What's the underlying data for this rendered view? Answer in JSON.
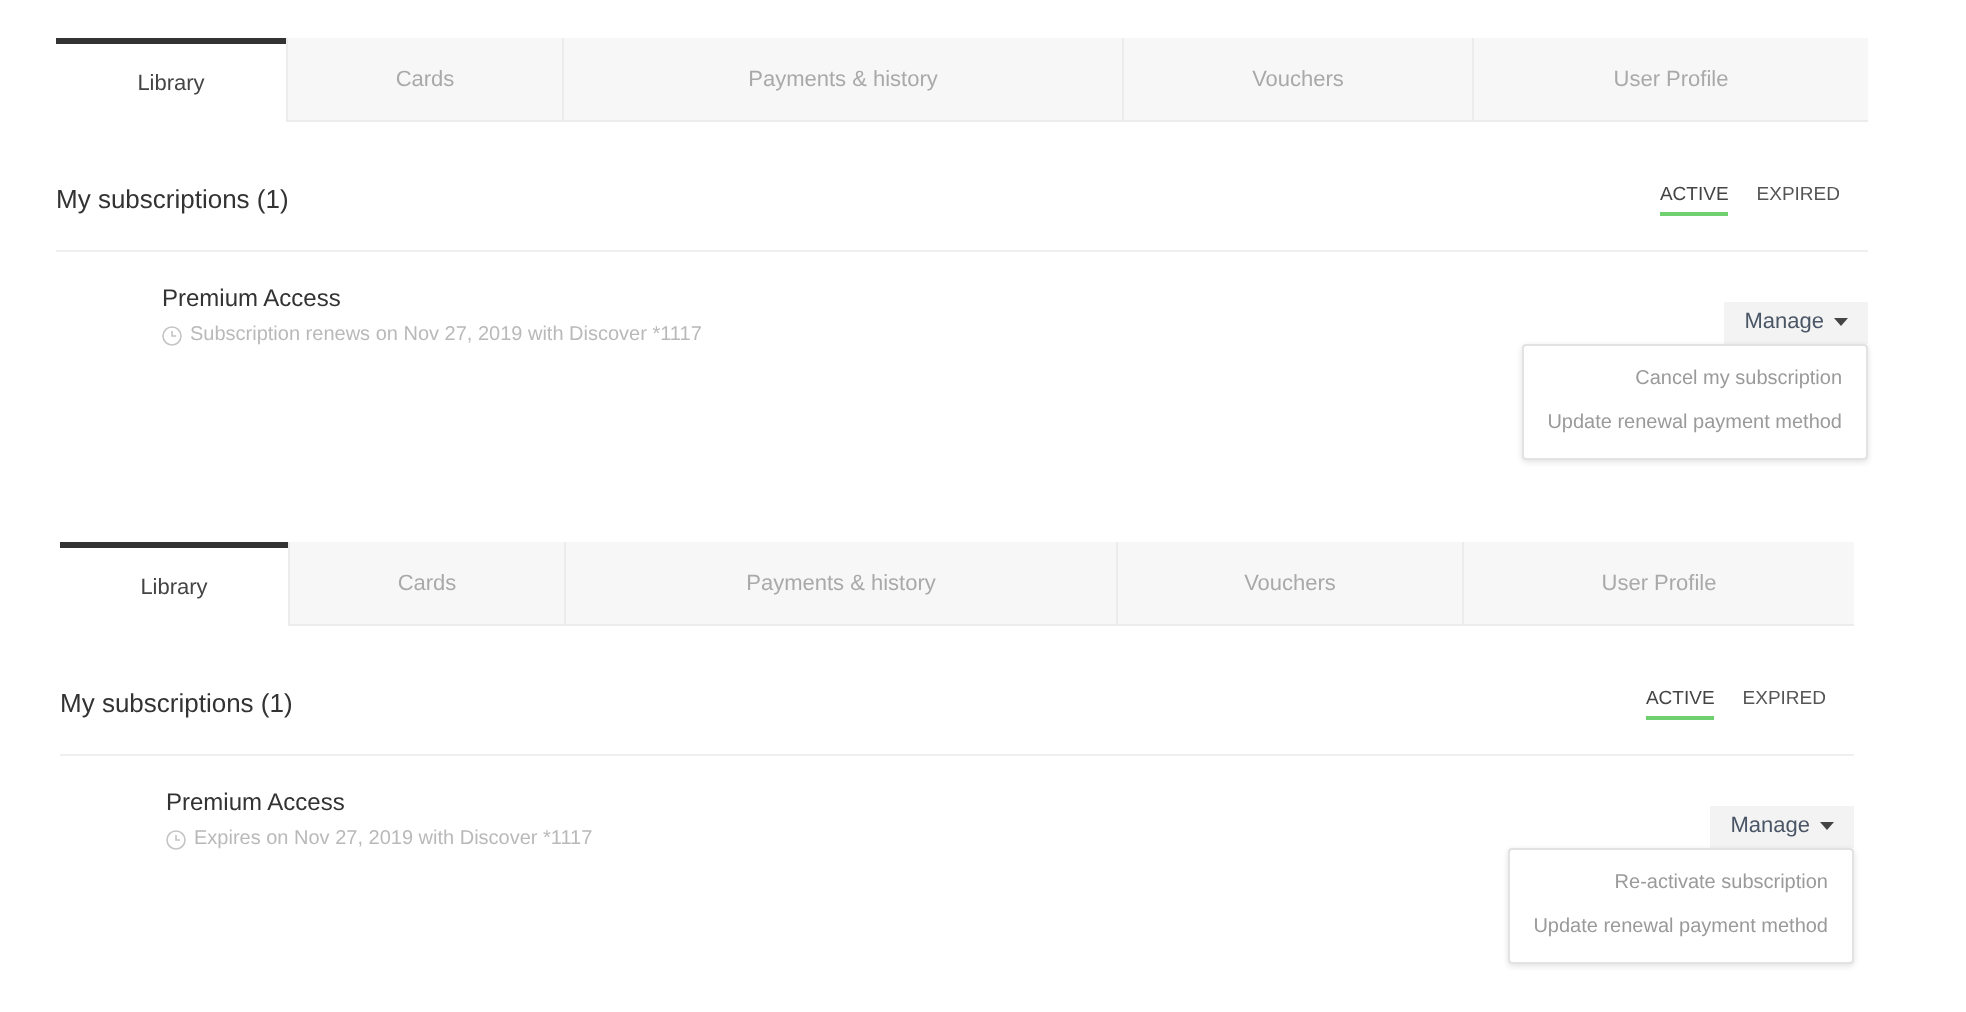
{
  "panels": [
    {
      "tabs": [
        {
          "label": "Library",
          "selected": true
        },
        {
          "label": "Cards",
          "selected": false
        },
        {
          "label": "Payments & history",
          "selected": false
        },
        {
          "label": "Vouchers",
          "selected": false
        },
        {
          "label": "User Profile",
          "selected": false
        }
      ],
      "title": "My subscriptions (1)",
      "filters": [
        {
          "label": "ACTIVE",
          "selected": true
        },
        {
          "label": "EXPIRED",
          "selected": false
        }
      ],
      "subscription": {
        "name": "Premium Access",
        "detail": "Subscription renews on Nov 27, 2019 with Discover *1117",
        "manage": "Manage",
        "menu": [
          "Cancel my subscription",
          "Update renewal payment method"
        ]
      }
    },
    {
      "tabs": [
        {
          "label": "Library",
          "selected": true
        },
        {
          "label": "Cards",
          "selected": false
        },
        {
          "label": "Payments & history",
          "selected": false
        },
        {
          "label": "Vouchers",
          "selected": false
        },
        {
          "label": "User Profile",
          "selected": false
        }
      ],
      "title": "My subscriptions (1)",
      "filters": [
        {
          "label": "ACTIVE",
          "selected": true
        },
        {
          "label": "EXPIRED",
          "selected": false
        }
      ],
      "subscription": {
        "name": "Premium Access",
        "detail": "Expires on Nov 27, 2019 with Discover *1117",
        "manage": "Manage",
        "menu": [
          "Re-activate subscription",
          "Update renewal payment method"
        ]
      }
    }
  ]
}
